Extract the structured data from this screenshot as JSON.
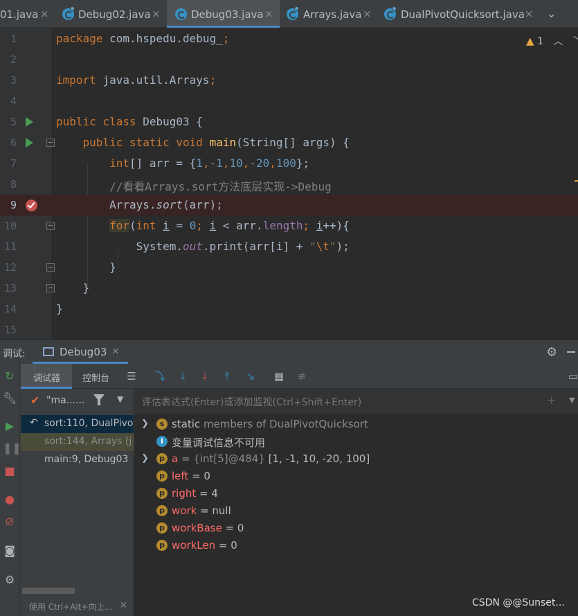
{
  "tabs": [
    {
      "label": "01.java",
      "active": false
    },
    {
      "label": "Debug02.java",
      "active": false
    },
    {
      "label": "Debug03.java",
      "active": true
    },
    {
      "label": "Arrays.java",
      "active": false
    },
    {
      "label": "DualPivotQuicksort.java",
      "active": false
    }
  ],
  "editor": {
    "warning_count": "1",
    "line_numbers": [
      "1",
      "2",
      "3",
      "4",
      "5",
      "6",
      "7",
      "8",
      "9",
      "10",
      "11",
      "12",
      "13",
      "14",
      "15"
    ],
    "lines": {
      "l1_kw": "package",
      "l1_rest": " com.hspedu.debug_",
      "l1_semi": ";",
      "l3_kw": "import",
      "l3_rest": " java.util.Arrays",
      "l3_semi": ";",
      "l5_kw": "public class",
      "l5_rest": " Debug03 {",
      "l6_kw": "public static void",
      "l6_fn": "main",
      "l6_rest": "(String[] args) {",
      "l7_kw": "int",
      "l7_a": "[] arr = {",
      "l7_n1": "1",
      "l7_n2": "-1",
      "l7_n3": "10",
      "l7_n4": "-20",
      "l7_n5": "100",
      "l7_end": "};",
      "l8_comment": "//看看Arrays.sort方法底层实现->Debug",
      "l9_a": "Arrays.",
      "l9_it": "sort",
      "l9_b": "(arr);",
      "l10_for": "for",
      "l10_a": "(",
      "l10_int": "int",
      "l10_i1": "i",
      "l10_eq": " = ",
      "l10_zero": "0",
      "l10_semi1": "; ",
      "l10_i2": "i",
      "l10_lt": " < arr.",
      "l10_len": "length",
      "l10_semi2": "; ",
      "l10_i3": "i",
      "l10_end": "++){",
      "l11_a": "System.",
      "l11_out": "out",
      "l11_b": ".print(arr[i] + ",
      "l11_str1": "\"",
      "l11_esc": "\\t",
      "l11_str2": "\"",
      "l11_end": ");",
      "l12": "}",
      "l13": "}",
      "l14": "}"
    }
  },
  "debug": {
    "title": "调试:",
    "session": "Debug03",
    "subtabs": [
      "调试器",
      "控制台"
    ],
    "thread_label": "\"ma......",
    "frames": [
      {
        "label": "sort:110, DualPivo",
        "state": "selected"
      },
      {
        "label": "sort:144, Arrays (j",
        "state": "dim"
      },
      {
        "label": "main:9, Debug03",
        "state": "normal"
      }
    ],
    "frames_hint": "使用 Ctrl+Alt+向上...",
    "eval_placeholder": "评估表达式(Enter)或添加监视(Ctrl+Shift+Enter)",
    "variables": [
      {
        "badge": "s",
        "name": "static",
        "value": " members of DualPivotQuicksort",
        "expandable": true
      },
      {
        "badge": "i",
        "name": "",
        "value": "变量调试信息不可用",
        "expandable": false
      },
      {
        "badge": "p",
        "name": "a",
        "type": " = {int[5]@484} ",
        "value": "[1, -1, 10, -20, 100]",
        "expandable": true
      },
      {
        "badge": "p",
        "name": "left",
        "value": " = 0",
        "expandable": false
      },
      {
        "badge": "p",
        "name": "right",
        "value": " = 4",
        "expandable": false
      },
      {
        "badge": "p",
        "name": "work",
        "value": " = null",
        "expandable": false
      },
      {
        "badge": "p",
        "name": "workBase",
        "value": " = 0",
        "expandable": false
      },
      {
        "badge": "p",
        "name": "workLen",
        "value": " = 0",
        "expandable": false
      }
    ]
  },
  "watermark": "CSDN @@Sunset...",
  "colors": {
    "accent": "#4a88c7",
    "breakpoint": "#c75450",
    "run": "#499c54",
    "var_name": "#ff6b68"
  },
  "icons": [
    "java-class-icon",
    "close-icon",
    "chevron-down-icon",
    "run-icon",
    "breakpoint-icon",
    "fold-icon",
    "warning-icon",
    "gear-icon",
    "console-icon",
    "filter-icon",
    "rerun-icon",
    "wrench-icon",
    "resume-icon",
    "pause-icon",
    "stop-icon",
    "view-breakpoints-icon",
    "mute-breakpoints-icon",
    "camera-icon",
    "settings-icon",
    "step-over-icon",
    "step-into-icon",
    "force-step-into-icon",
    "step-out-icon",
    "run-to-cursor-icon",
    "evaluate-icon",
    "trace-icon"
  ]
}
